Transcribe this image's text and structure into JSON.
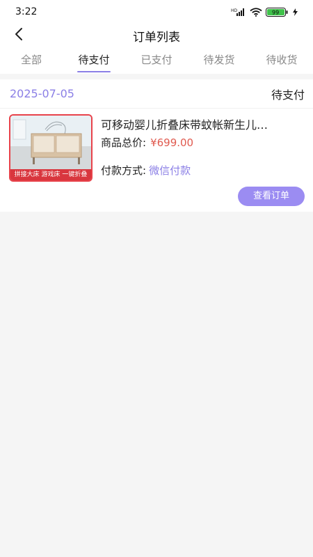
{
  "status_bar": {
    "time": "3:22",
    "network_label": "HD",
    "battery": "99"
  },
  "nav": {
    "title": "订单列表"
  },
  "tabs": [
    {
      "label": "全部",
      "active": false
    },
    {
      "label": "待支付",
      "active": true
    },
    {
      "label": "已支付",
      "active": false
    },
    {
      "label": "待发货",
      "active": false
    },
    {
      "label": "待收货",
      "active": false
    }
  ],
  "order": {
    "date": "2025-07-05",
    "status": "待支付",
    "product_name": "可移动婴儿折叠床带蚊帐新生儿…",
    "price_label": "商品总价:",
    "price_value": "¥699.00",
    "pay_label": "付款方式:",
    "pay_value": "微信付款",
    "thumb_banner": "拼接大床  游戏床  一键折叠",
    "view_button": "查看订单"
  },
  "colors": {
    "accent": "#8b7fe6",
    "button": "#9b8cf2",
    "price": "#e05a4f",
    "banner": "#d9363e"
  }
}
